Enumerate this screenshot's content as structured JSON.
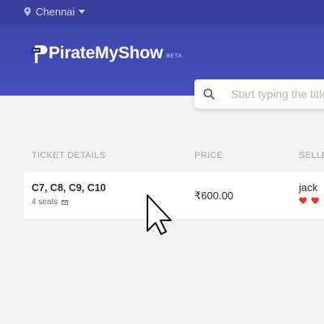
{
  "topbar": {
    "city": "Chennai",
    "pin_icon": "location-pin-icon",
    "caret_icon": "caret-down-icon"
  },
  "brand": {
    "name": "PirateMyShow",
    "badge": "BETA"
  },
  "search": {
    "placeholder": "Start typing the title",
    "icon": "search-icon"
  },
  "table": {
    "headers": [
      "TICKET DETAILS",
      "PRICE",
      "SELLER"
    ],
    "rows": [
      {
        "seats": "C7, C8, C9, C10",
        "seat_count": "4 seats",
        "price": "₹600.00",
        "seller": "jack",
        "rating_hearts": 2
      }
    ]
  },
  "colors": {
    "topbar": "#3a3f9e",
    "hero": "#4249b3",
    "accent": "#e0372c",
    "background": "#f3f3f4"
  }
}
